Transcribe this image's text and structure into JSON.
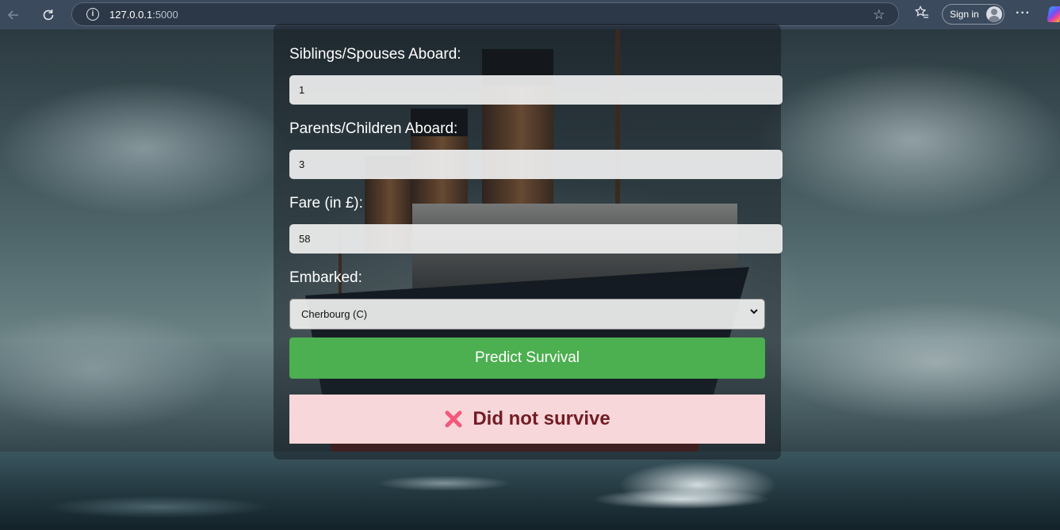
{
  "browser": {
    "url_host": "127.0.0.1",
    "url_port": ":5000",
    "sign_in_label": "Sign in",
    "more_label": "···"
  },
  "form": {
    "siblings_label": "Siblings/Spouses Aboard:",
    "siblings_value": "1",
    "parents_label": "Parents/Children Aboard:",
    "parents_value": "3",
    "fare_label": "Fare (in £):",
    "fare_value": "58",
    "embarked_label": "Embarked:",
    "embarked_selected": "Cherbourg (C)",
    "predict_label": "Predict Survival"
  },
  "result": {
    "icon": "cross-mark-icon",
    "text": "Did not survive"
  },
  "colors": {
    "predict_button": "#4caf50",
    "result_background": "#f8d7da",
    "result_text": "#721c24",
    "result_icon": "#f2587a"
  }
}
